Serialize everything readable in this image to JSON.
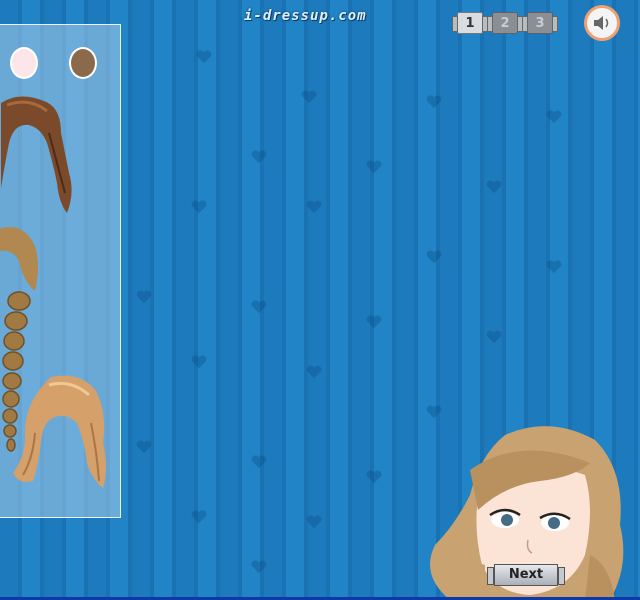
{
  "header": {
    "site_logo": "i-dressup.com"
  },
  "pager": {
    "pages": [
      "1",
      "2",
      "3"
    ],
    "active_page": "1"
  },
  "panel": {
    "color_swatches": [
      {
        "name": "light",
        "color": "#fde6ea"
      },
      {
        "name": "brown",
        "color": "#8a6a4a"
      }
    ],
    "hair_options": [
      "brown-curly-hair",
      "blonde-braid-hair",
      "light-brown-wavy-hair"
    ]
  },
  "footer": {
    "next_label": "Next"
  },
  "colors": {
    "background": "#1e7fc1",
    "sound_ring": "#f0a070"
  }
}
